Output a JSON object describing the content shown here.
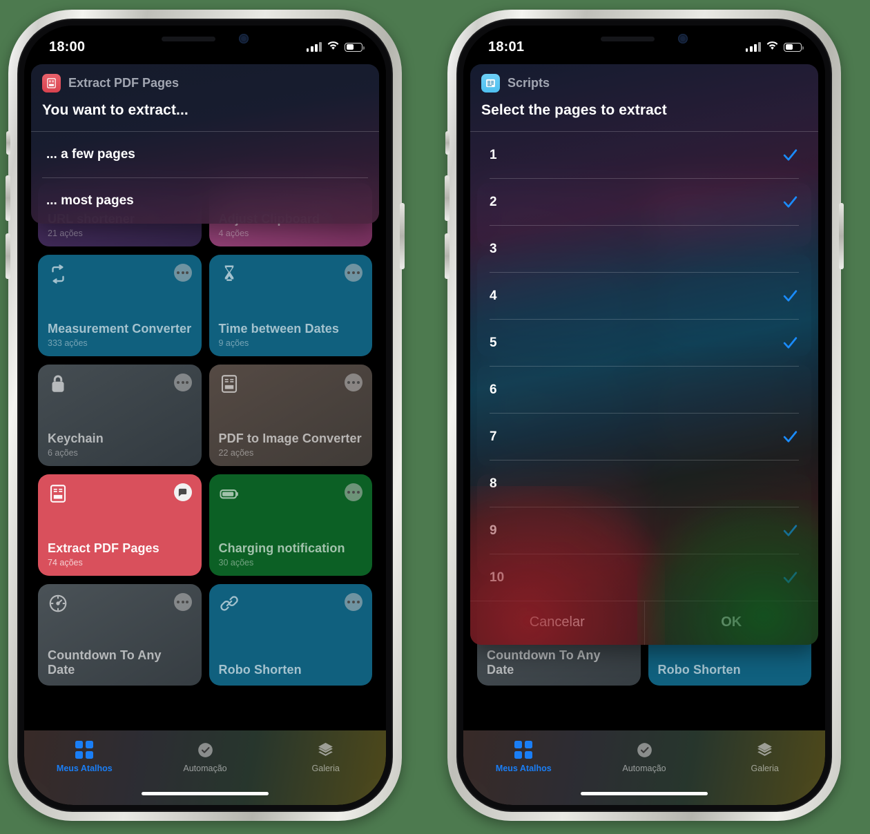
{
  "background_color": "#4d7a4f",
  "accent_blue": "#1a7ef5",
  "phones": [
    {
      "id": "left",
      "status": {
        "time": "18:00",
        "cellular_bars": 3,
        "wifi": "wifi-icon",
        "battery_percent": 52
      },
      "dialog": {
        "kind": "choose-from-menu",
        "app_name": "Extract PDF Pages",
        "app_icon": "pdf-doc-icon",
        "title": "You want to extract...",
        "options": [
          "... a few pages",
          "... most pages"
        ]
      }
    },
    {
      "id": "right",
      "status": {
        "time": "18:01",
        "cellular_bars": 3,
        "wifi": "wifi-icon",
        "battery_percent": 52
      },
      "dialog": {
        "kind": "choose-from-list",
        "app_name": "Scripts",
        "app_icon": "scripts-icon",
        "title": "Select the pages to extract",
        "rows": [
          {
            "label": "1",
            "checked": true
          },
          {
            "label": "2",
            "checked": true
          },
          {
            "label": "3",
            "checked": false
          },
          {
            "label": "4",
            "checked": true
          },
          {
            "label": "5",
            "checked": true
          },
          {
            "label": "6",
            "checked": false
          },
          {
            "label": "7",
            "checked": true
          },
          {
            "label": "8",
            "checked": false
          },
          {
            "label": "9",
            "checked": true
          },
          {
            "label": "10",
            "checked": true
          }
        ],
        "cancel_label": "Cancelar",
        "ok_label": "OK"
      }
    }
  ],
  "shortcuts": [
    {
      "name": "URL shortener",
      "subtitle": "21 ações",
      "color": "#3e2a55",
      "icon": "link-icon",
      "menu": "ellipsis-icon",
      "partial": true,
      "bright": false
    },
    {
      "name": "Adjust Clipboard",
      "subtitle": "4 ações",
      "color": "#8c3a70",
      "icon": "clipboard-icon",
      "menu": "ellipsis-icon",
      "partial": true,
      "bright": false
    },
    {
      "name": "Measurement Converter",
      "subtitle": "333 ações",
      "color": "#10607e",
      "icon": "convert-icon",
      "menu": "ellipsis-icon",
      "partial": false,
      "bright": false
    },
    {
      "name": "Time between Dates",
      "subtitle": "9 ações",
      "color": "#10607e",
      "icon": "hourglass-icon",
      "menu": "ellipsis-icon",
      "partial": false,
      "bright": false
    },
    {
      "name": "Keychain",
      "subtitle": "6 ações",
      "color": "#3b4348",
      "icon": "lock-icon",
      "menu": "ellipsis-icon",
      "partial": false,
      "bright": false
    },
    {
      "name": "PDF to Image Converter",
      "subtitle": "22 ações",
      "color": "#4a413d",
      "icon": "pdf-doc-icon",
      "menu": "ellipsis-icon",
      "partial": false,
      "bright": false
    },
    {
      "name": "Extract PDF Pages",
      "subtitle": "74 ações",
      "color": "#d9505c",
      "icon": "pdf-doc-icon",
      "menu": "chat-bubble-icon",
      "partial": false,
      "bright": true
    },
    {
      "name": "Charging notification",
      "subtitle": "30 ações",
      "color": "#0c6025",
      "icon": "battery-icon",
      "menu": "ellipsis-icon",
      "partial": false,
      "bright": false
    },
    {
      "name": "Countdown To Any Date",
      "subtitle": "",
      "color": "#3f474c",
      "icon": "gauge-icon",
      "menu": "ellipsis-icon",
      "partial": false,
      "bright": false
    },
    {
      "name": "Robo Shorten",
      "subtitle": "",
      "color": "#10607e",
      "icon": "link-icon",
      "menu": "ellipsis-icon",
      "partial": false,
      "bright": false
    }
  ],
  "tabbar": {
    "tabs": [
      {
        "label": "Meus Atalhos",
        "icon": "grid-squares-icon",
        "active": true
      },
      {
        "label": "Automação",
        "icon": "clock-icon",
        "active": false
      },
      {
        "label": "Galeria",
        "icon": "layers-icon",
        "active": false
      }
    ]
  }
}
